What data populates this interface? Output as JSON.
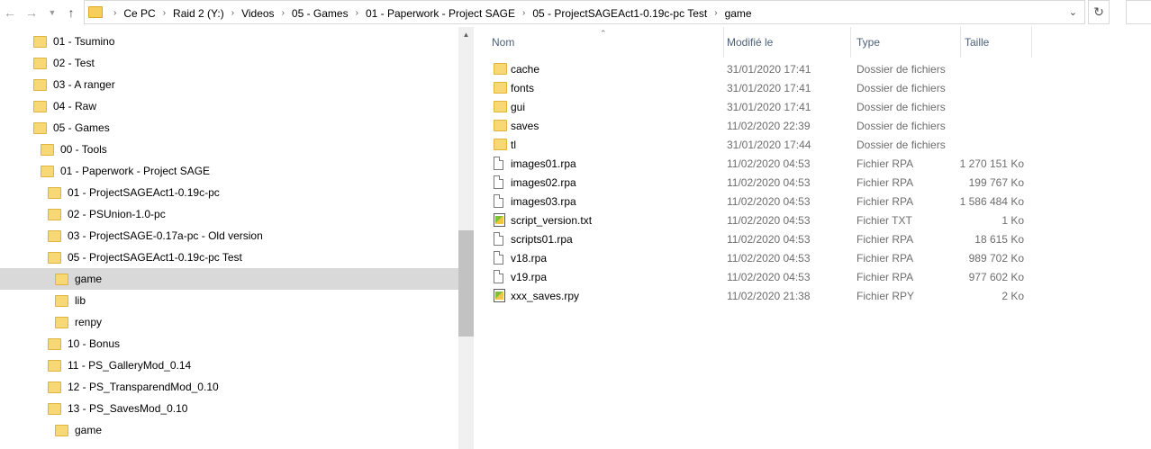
{
  "address_bar": {
    "crumbs": [
      "Ce PC",
      "Raid 2 (Y:)",
      "Videos",
      "05 - Games",
      "01 - Paperwork - Project SAGE",
      "05 - ProjectSAGEAct1-0.19c-pc Test",
      "game"
    ]
  },
  "nav_tree": [
    {
      "label": "01 - Tsumino",
      "level": 0,
      "selected": false
    },
    {
      "label": "02 - Test",
      "level": 0,
      "selected": false
    },
    {
      "label": "03 - A ranger",
      "level": 0,
      "selected": false
    },
    {
      "label": "04 - Raw",
      "level": 0,
      "selected": false
    },
    {
      "label": "05 - Games",
      "level": 0,
      "selected": false
    },
    {
      "label": "00 - Tools",
      "level": 1,
      "selected": false
    },
    {
      "label": "01 - Paperwork - Project SAGE",
      "level": 1,
      "selected": false
    },
    {
      "label": "01 - ProjectSAGEAct1-0.19c-pc",
      "level": 2,
      "selected": false
    },
    {
      "label": "02 - PSUnion-1.0-pc",
      "level": 2,
      "selected": false
    },
    {
      "label": "03 - ProjectSAGE-0.17a-pc - Old version",
      "level": 2,
      "selected": false
    },
    {
      "label": "05 - ProjectSAGEAct1-0.19c-pc Test",
      "level": 2,
      "selected": false
    },
    {
      "label": "game",
      "level": 3,
      "selected": true
    },
    {
      "label": "lib",
      "level": 3,
      "selected": false
    },
    {
      "label": "renpy",
      "level": 3,
      "selected": false
    },
    {
      "label": "10 - Bonus",
      "level": 2,
      "selected": false
    },
    {
      "label": "11 - PS_GalleryMod_0.14",
      "level": 2,
      "selected": false
    },
    {
      "label": "12 - PS_TransparendMod_0.10",
      "level": 2,
      "selected": false
    },
    {
      "label": "13 - PS_SavesMod_0.10",
      "level": 2,
      "selected": false
    },
    {
      "label": "game",
      "level": 3,
      "selected": false
    }
  ],
  "columns": {
    "name": "Nom",
    "modified": "Modifié le",
    "type": "Type",
    "size": "Taille"
  },
  "files": [
    {
      "name": "cache",
      "modified": "31/01/2020 17:41",
      "type": "Dossier de fichiers",
      "size": "",
      "icon": "folder-icon"
    },
    {
      "name": "fonts",
      "modified": "31/01/2020 17:41",
      "type": "Dossier de fichiers",
      "size": "",
      "icon": "folder-icon"
    },
    {
      "name": "gui",
      "modified": "31/01/2020 17:41",
      "type": "Dossier de fichiers",
      "size": "",
      "icon": "folder-icon"
    },
    {
      "name": "saves",
      "modified": "11/02/2020 22:39",
      "type": "Dossier de fichiers",
      "size": "",
      "icon": "folder-icon"
    },
    {
      "name": "tl",
      "modified": "31/01/2020 17:44",
      "type": "Dossier de fichiers",
      "size": "",
      "icon": "folder-icon"
    },
    {
      "name": "images01.rpa",
      "modified": "11/02/2020 04:53",
      "type": "Fichier RPA",
      "size": "1 270 151 Ko",
      "icon": "file-icon"
    },
    {
      "name": "images02.rpa",
      "modified": "11/02/2020 04:53",
      "type": "Fichier RPA",
      "size": "199 767 Ko",
      "icon": "file-icon"
    },
    {
      "name": "images03.rpa",
      "modified": "11/02/2020 04:53",
      "type": "Fichier RPA",
      "size": "1 586 484 Ko",
      "icon": "file-icon"
    },
    {
      "name": "script_version.txt",
      "modified": "11/02/2020 04:53",
      "type": "Fichier TXT",
      "size": "1 Ko",
      "icon": "script-file-icon"
    },
    {
      "name": "scripts01.rpa",
      "modified": "11/02/2020 04:53",
      "type": "Fichier RPA",
      "size": "18 615 Ko",
      "icon": "file-icon"
    },
    {
      "name": "v18.rpa",
      "modified": "11/02/2020 04:53",
      "type": "Fichier RPA",
      "size": "989 702 Ko",
      "icon": "file-icon"
    },
    {
      "name": "v19.rpa",
      "modified": "11/02/2020 04:53",
      "type": "Fichier RPA",
      "size": "977 602 Ko",
      "icon": "file-icon"
    },
    {
      "name": "xxx_saves.rpy",
      "modified": "11/02/2020 21:38",
      "type": "Fichier RPY",
      "size": "2 Ko",
      "icon": "script-file-icon"
    }
  ]
}
